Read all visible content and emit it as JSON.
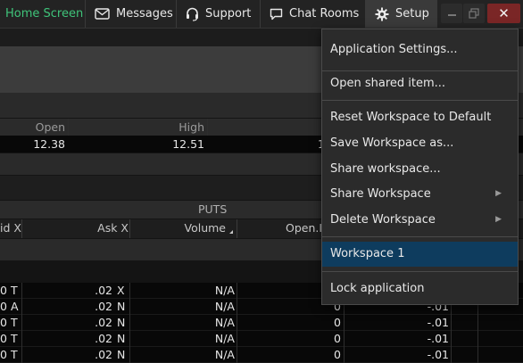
{
  "topbar": {
    "home_label": "Home Screen",
    "messages_label": "Messages",
    "support_label": "Support",
    "chatrooms_label": "Chat Rooms",
    "setup_label": "Setup",
    "close_glyph": "✕",
    "minimize_glyph": "–",
    "restore_glyph": "❐"
  },
  "quote": {
    "headers": [
      "Open",
      "High"
    ],
    "values": [
      "12.38",
      "12.51"
    ],
    "truncated_value": "1"
  },
  "options": {
    "puts_label": "PUTS",
    "headers": {
      "bid_x": "id X",
      "ask_x": "Ask X",
      "volume": "Volume",
      "open_int": "Open.I"
    },
    "rows": [
      {
        "c0": "0",
        "c1": "T",
        "ask": ".02",
        "askx": "X",
        "vol": "N/A",
        "oi": "",
        "chg": ""
      },
      {
        "c0": "0",
        "c1": "A",
        "ask": ".02",
        "askx": "N",
        "vol": "N/A",
        "oi": "0",
        "chg": "-.01"
      },
      {
        "c0": "0",
        "c1": "T",
        "ask": ".02",
        "askx": "N",
        "vol": "N/A",
        "oi": "0",
        "chg": "-.01"
      },
      {
        "c0": "0",
        "c1": "T",
        "ask": ".02",
        "askx": "N",
        "vol": "N/A",
        "oi": "0",
        "chg": "-.01"
      },
      {
        "c0": "0",
        "c1": "T",
        "ask": ".02",
        "askx": "N",
        "vol": "N/A",
        "oi": "0",
        "chg": "-.01"
      }
    ]
  },
  "menu": {
    "items": [
      {
        "label": "Application Settings..."
      },
      {
        "label": "Open shared item..."
      },
      {
        "label": "Reset Workspace to Default"
      },
      {
        "label": "Save Workspace as..."
      },
      {
        "label": "Share workspace..."
      },
      {
        "label": "Share Workspace"
      },
      {
        "label": "Delete Workspace"
      },
      {
        "label": "Workspace 1"
      },
      {
        "label": "Lock application"
      }
    ],
    "submenu_arrow": "▶"
  },
  "colors": {
    "home_accent": "#3fc47a",
    "selection": "#0e3c5e",
    "close_button": "#7a2626"
  },
  "icons": [
    "envelope-icon",
    "headset-icon",
    "chat-bubble-icon",
    "gear-icon"
  ]
}
